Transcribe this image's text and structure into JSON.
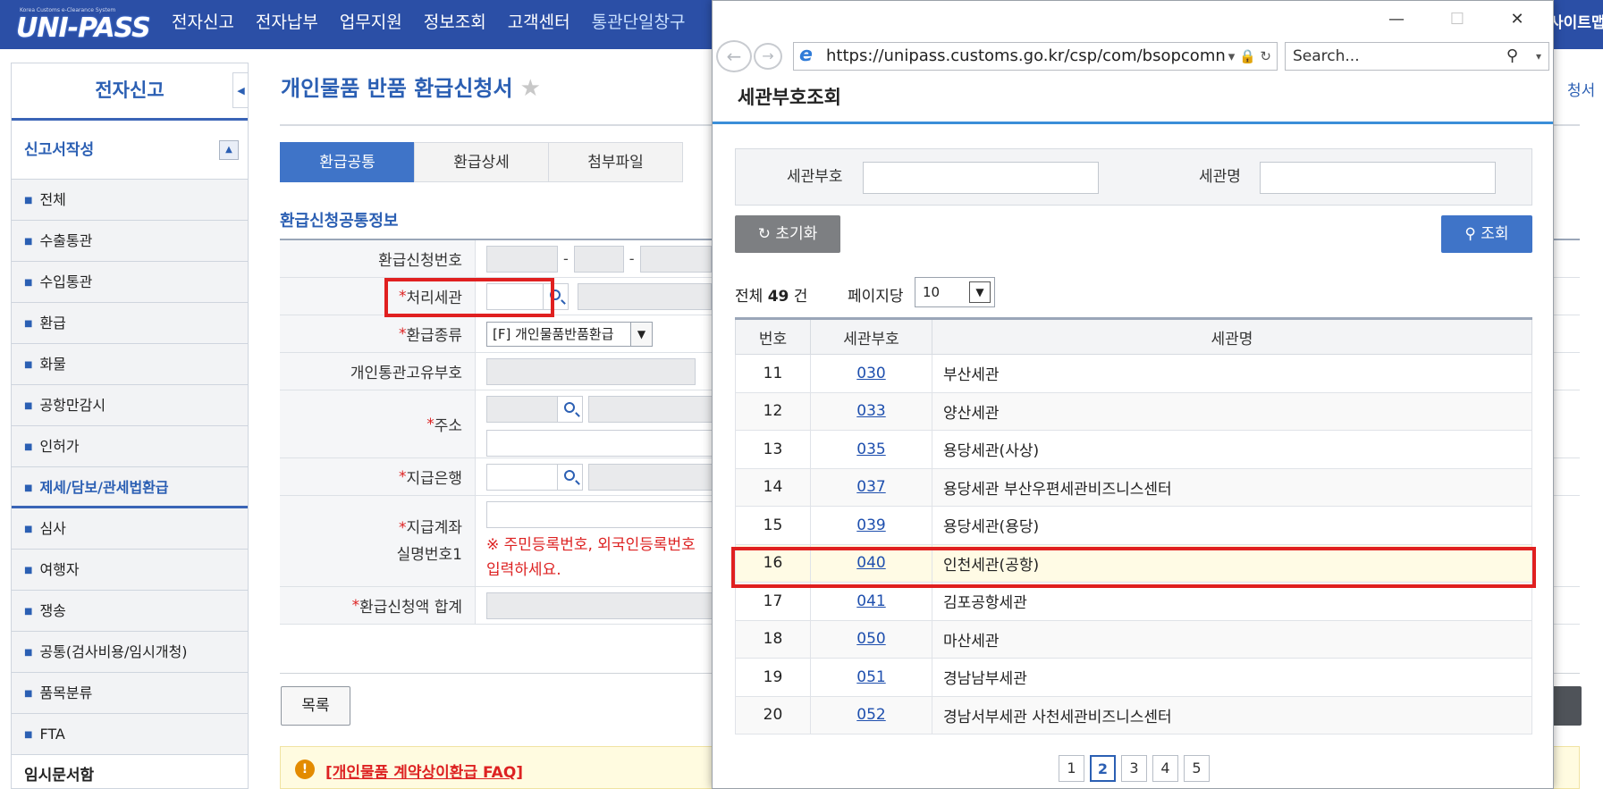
{
  "topbar": {
    "logo_sub": "Korea Customs e-Clearance System",
    "logo_main": "UNI-PASS",
    "nav": [
      "전자신고",
      "전자납부",
      "업무지원",
      "정보조회",
      "고객센터",
      "통관단일창구"
    ],
    "sitemap": "사이트맵"
  },
  "sidebar": {
    "title": "전자신고",
    "collapse_icon": "◀",
    "section": "신고서작성",
    "section_toggle": "▲",
    "items": [
      "전체",
      "수출통관",
      "수입통관",
      "환급",
      "화물",
      "공항만감시",
      "인허가",
      "제세/담보/관세법환급",
      "심사",
      "여행자",
      "쟁송",
      "공통(검사비용/임시개청)",
      "품목분류",
      "FTA"
    ],
    "active_item": "제세/담보/관세법환급",
    "extra": "임시문서함"
  },
  "main": {
    "page_title": "개인물품 반품 환급신청서",
    "star": "★",
    "right_link": "청서",
    "tabs": [
      {
        "label": "환급공통",
        "active": true
      },
      {
        "label": "환급상세",
        "active": false
      },
      {
        "label": "첨부파일",
        "active": false
      }
    ],
    "section_title": "환급신청공통정보",
    "form": {
      "refund_no": "환급신청번호",
      "customs": "처리세관",
      "refund_type": "환급종류",
      "refund_type_value": "[F] 개인물품반품환급",
      "personal_id": "개인통관고유부호",
      "address": "주소",
      "bank": "지급은행",
      "account_1": "지급계좌",
      "account_2": "실명번호1",
      "warning_1": "※ 주민등록번호, 외국인등록번호",
      "warning_2": "입력하세요.",
      "total": "환급신청액 합계",
      "required_mark": "*",
      "dash": "-"
    },
    "list_button": "목록",
    "faq_icon": "!",
    "faq_link": "[개인물품 계약상이환급 FAQ]"
  },
  "popup": {
    "window_buttons": {
      "minimize": "—",
      "maximize": "☐",
      "close": "✕"
    },
    "nav_back": "←",
    "nav_forward": "→",
    "url": "https://unipass.customs.go.kr/csp/com/bsopcomn/ba",
    "url_icon": "e",
    "url_icons": "▾ 🔒 ↻",
    "search_placeholder": "Search...",
    "search_icon": "⚲",
    "search_dropdown": "▾",
    "header": "세관부호조회",
    "filter": {
      "code_label": "세관부호",
      "name_label": "세관명"
    },
    "reset_button": "↻  초기화",
    "query_button": "⚲  조회",
    "total_prefix": "전체",
    "total_count": "49",
    "total_suffix": "건",
    "per_page_label": "페이지당",
    "per_page_value": "10",
    "per_page_arrow": "▼",
    "columns": [
      "번호",
      "세관부호",
      "세관명"
    ],
    "rows": [
      {
        "no": "11",
        "code": "030",
        "name": "부산세관"
      },
      {
        "no": "12",
        "code": "033",
        "name": "양산세관"
      },
      {
        "no": "13",
        "code": "035",
        "name": "용당세관(사상)"
      },
      {
        "no": "14",
        "code": "037",
        "name": "용당세관 부산우편세관비즈니스센터"
      },
      {
        "no": "15",
        "code": "039",
        "name": "용당세관(용당)"
      },
      {
        "no": "16",
        "code": "040",
        "name": "인천세관(공항)"
      },
      {
        "no": "17",
        "code": "041",
        "name": "김포공항세관"
      },
      {
        "no": "18",
        "code": "050",
        "name": "마산세관"
      },
      {
        "no": "19",
        "code": "051",
        "name": "경남남부세관"
      },
      {
        "no": "20",
        "code": "052",
        "name": "경남서부세관 사천세관비즈니스센터"
      }
    ],
    "selected_row": "16",
    "pages": [
      "1",
      "2",
      "3",
      "4",
      "5"
    ],
    "current_page": "2"
  }
}
